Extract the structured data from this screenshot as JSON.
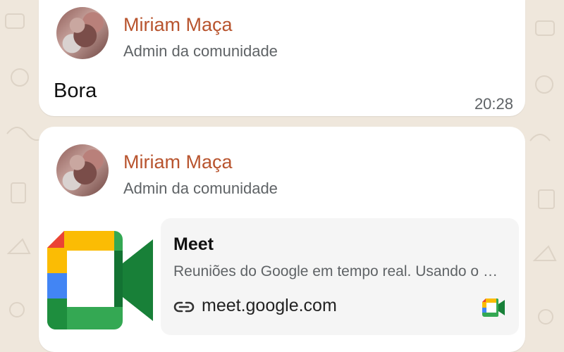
{
  "messages": [
    {
      "sender": "Miriam Maça",
      "role": "Admin da comunidade",
      "text": "Bora",
      "time": "20:28"
    },
    {
      "sender": "Miriam Maça",
      "role": "Admin da comunidade",
      "link_preview": {
        "title": "Meet",
        "description": "Reuniões do Google em tempo real. Usando o navegador, compartilhe seu vídeo, computador e apresentações com colegas de equipe e clientes.",
        "domain": "meet.google.com",
        "icon": "google-meet-logo"
      }
    }
  ],
  "colors": {
    "background": "#efe7dc",
    "bubble": "#ffffff",
    "sender": "#b8542e",
    "muted_text": "#5f6366",
    "preview_card": "#f5f5f5"
  },
  "icons": {
    "link": "link-icon",
    "avatar": "avatar-photo"
  }
}
